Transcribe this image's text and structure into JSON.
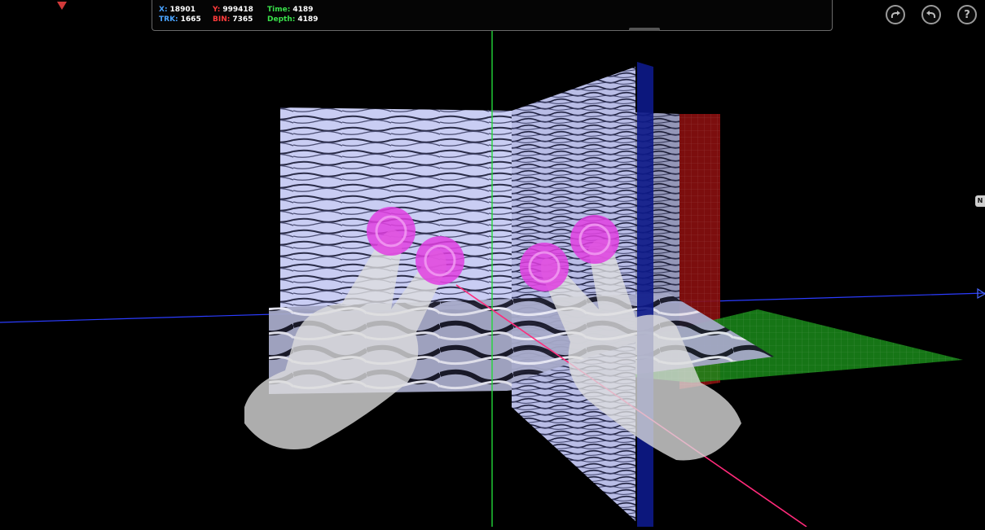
{
  "readouts": {
    "x": {
      "label": "X:",
      "value": "18901",
      "color": "#4aa3ff"
    },
    "y": {
      "label": "Y:",
      "value": "999418",
      "color": "#ff3b3b"
    },
    "time": {
      "label": "Time:",
      "value": "4189",
      "color": "#39e04a"
    },
    "trk": {
      "label": "TRK:",
      "value": "1665",
      "color": "#4aa3ff"
    },
    "bin": {
      "label": "BIN:",
      "value": "7365",
      "color": "#ff3b3b"
    },
    "depth": {
      "label": "Depth:",
      "value": "4189",
      "color": "#39e04a"
    }
  },
  "toolbar": {
    "redo_icon": "redo-icon",
    "undo_icon": "undo-icon",
    "help_label": "?"
  },
  "side_marker_label": "N",
  "scene": {
    "background": "#000000",
    "axis_colors": {
      "x": "#2b3cff",
      "y": "#22d63a",
      "z": "#ff2a7a"
    },
    "seismic_tint": "#c8ccf0",
    "touch_color": "#e040e0"
  }
}
